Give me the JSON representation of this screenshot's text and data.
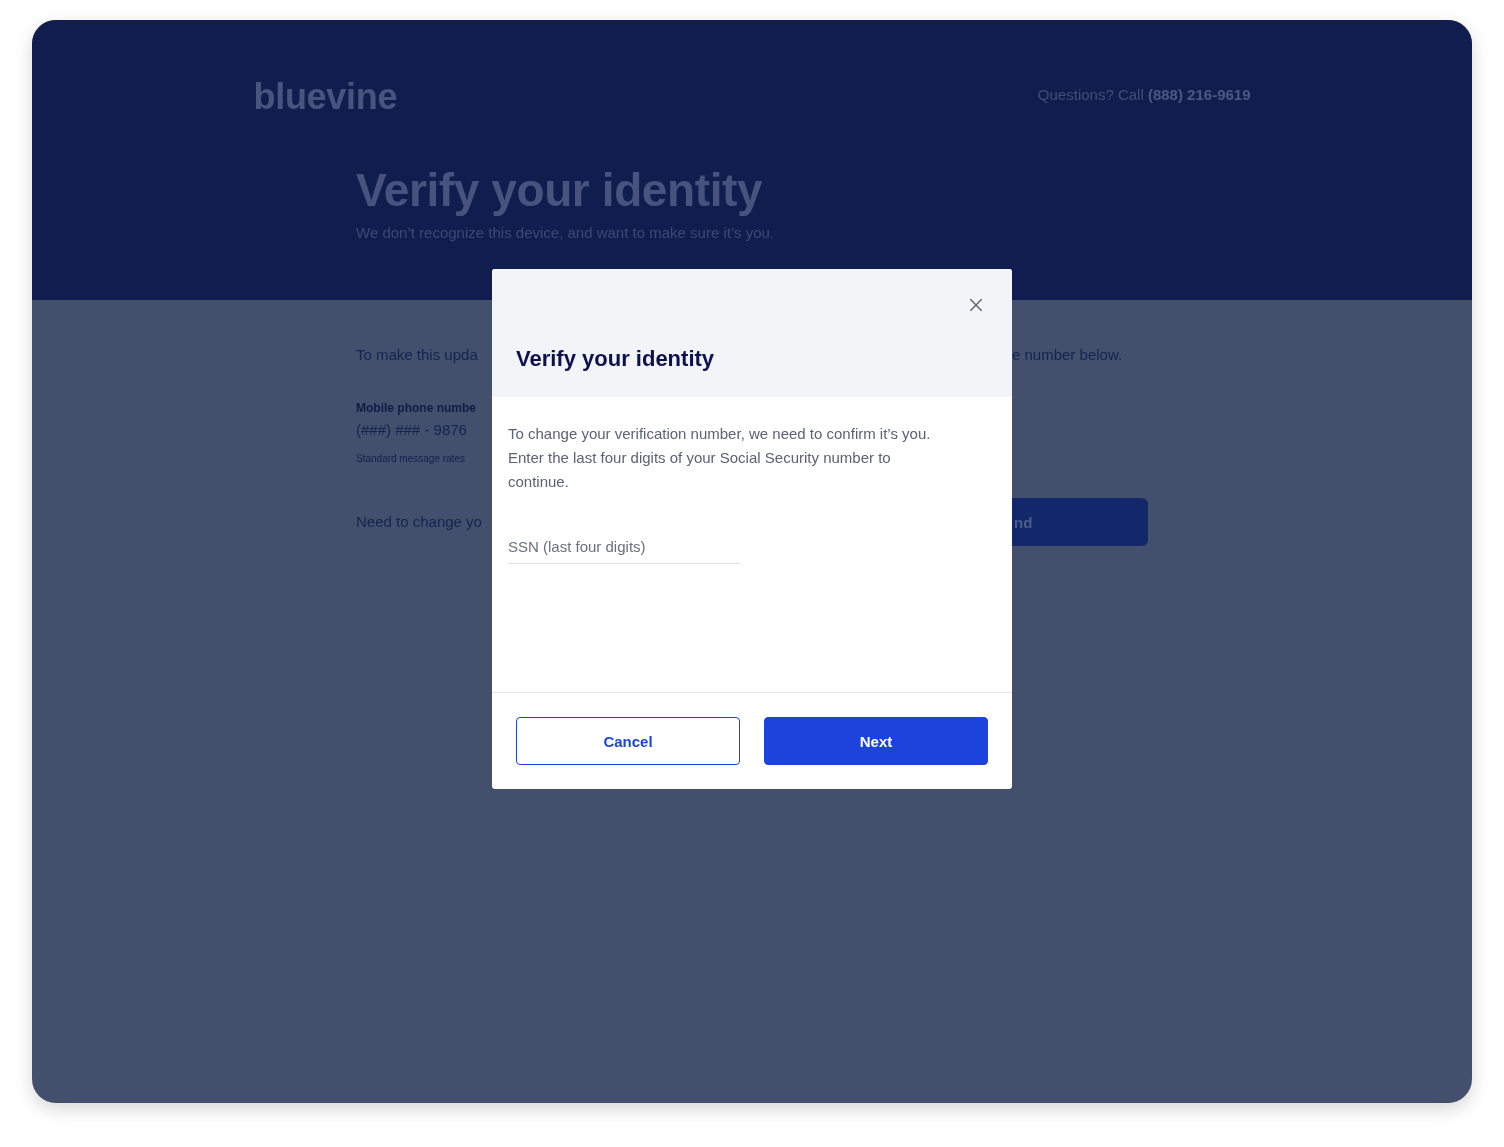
{
  "brand": {
    "logo": "bluevine",
    "support": "Questions? Call **(888) 216-9619**"
  },
  "hero": {
    "title": "Verify your identity",
    "subtitle": "We don’t recognize this device, and want to make sure it’s you."
  },
  "content": {
    "intro_left": "To make this upda",
    "intro_right": "e number below.",
    "phone": {
      "label": "Mobile phone numbe",
      "value": "(###) ### - 9876",
      "note": "Standard message rates"
    },
    "change_prompt": "Need to change yo",
    "action_button": "nd"
  },
  "modal": {
    "title": "Verify your identity",
    "body": "To change your verification number, we need to confirm it’s you. Enter the last four digits of your Social Security number to continue.",
    "ssn_field": {
      "placeholder": "SSN (last four digits)"
    },
    "buttons": [
      {
        "label": "Cancel",
        "kind": "secondary"
      },
      {
        "label": "Next",
        "kind": "primary"
      }
    ]
  }
}
